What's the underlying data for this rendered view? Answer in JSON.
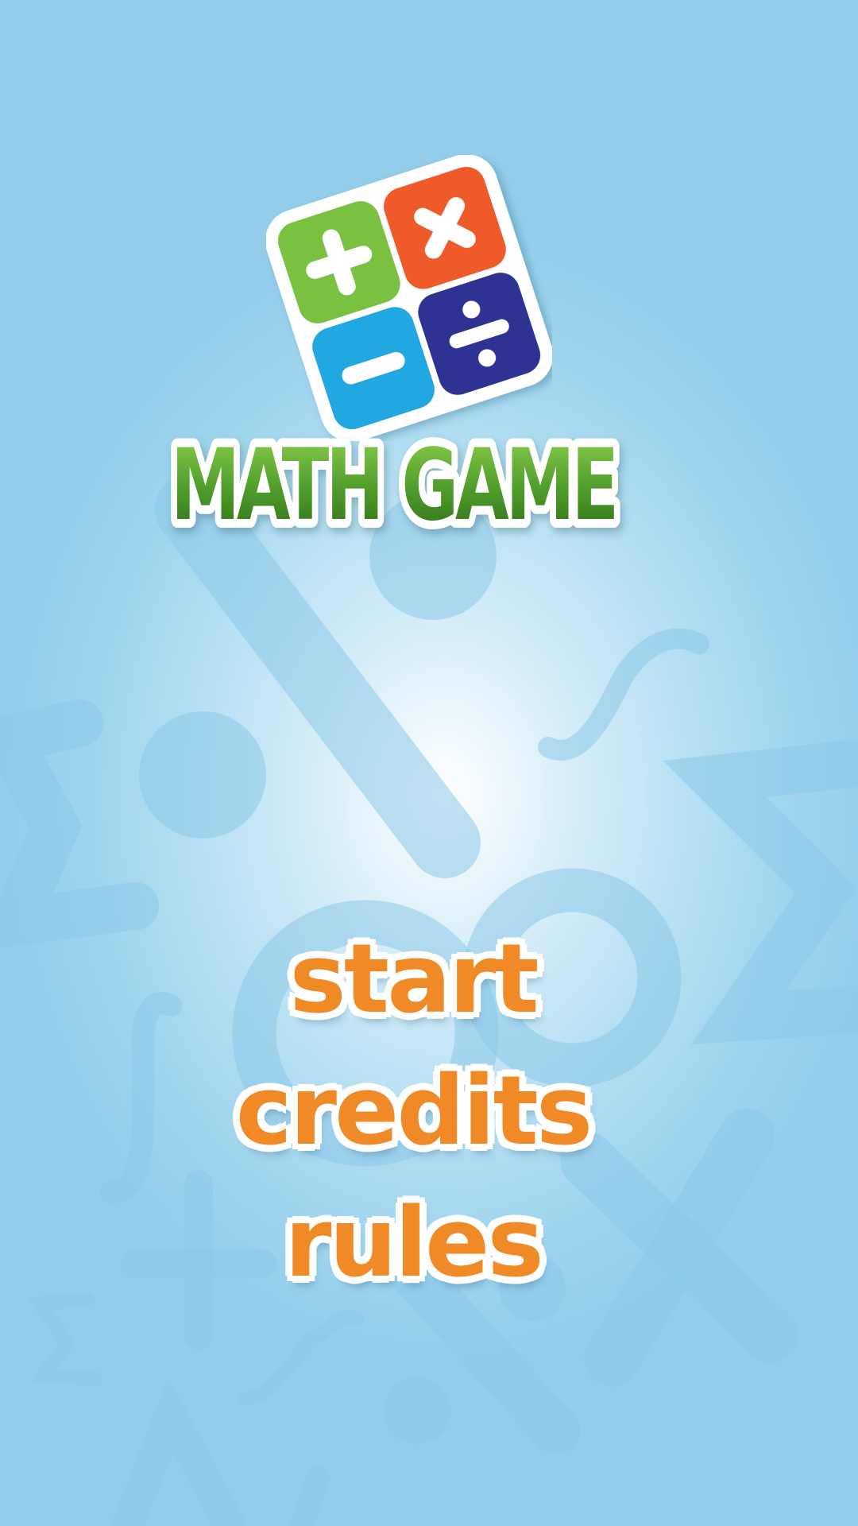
{
  "logo": {
    "title": "MATH GAME",
    "tiles": [
      {
        "symbol": "+",
        "color": "#7ac143",
        "icon": "plus-icon"
      },
      {
        "symbol": "×",
        "color": "#ee5a2a",
        "icon": "multiply-icon"
      },
      {
        "symbol": "−",
        "color": "#22a8e0",
        "icon": "minus-icon"
      },
      {
        "symbol": "÷",
        "color": "#2e3192",
        "icon": "divide-icon"
      }
    ]
  },
  "menu": {
    "start_label": "start",
    "credits_label": "credits",
    "rules_label": "rules"
  },
  "colors": {
    "menu_text": "#ef8a26",
    "title_green": "#4c9a2a",
    "background": "#9fd4ee"
  }
}
